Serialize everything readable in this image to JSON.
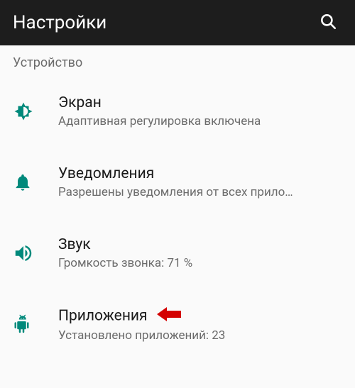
{
  "appbar": {
    "title": "Настройки"
  },
  "section": {
    "label": "Устройство"
  },
  "items": [
    {
      "title": "Экран",
      "subtitle": "Адаптивная регулировка включена"
    },
    {
      "title": "Уведомления",
      "subtitle": "Разрешены уведомления от всех прило…"
    },
    {
      "title": "Звук",
      "subtitle": "Громкость звонка: 71 %"
    },
    {
      "title": "Приложения",
      "subtitle": "Установлено приложений: 23"
    }
  ]
}
